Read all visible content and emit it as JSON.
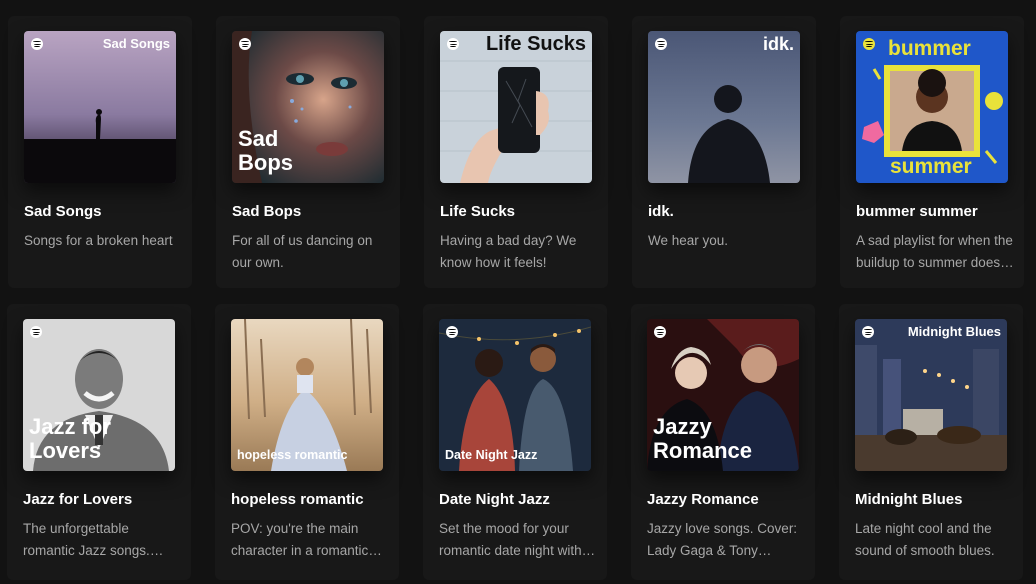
{
  "cards": [
    {
      "title": "Sad Songs",
      "desc": "Songs for a broken heart",
      "art_label": "Sad Songs"
    },
    {
      "title": "Sad Bops",
      "desc": "For all of us dancing on our own.",
      "art_label": "Sad Bops"
    },
    {
      "title": "Life Sucks",
      "desc": "Having a bad day? We know how it feels!",
      "art_label": "Life Sucks"
    },
    {
      "title": "idk.",
      "desc": "We hear you.",
      "art_label": "idk."
    },
    {
      "title": "bummer summer",
      "desc": "A sad playlist for when the buildup to summer doesn't quite pan out.",
      "art_label_top": "bummer",
      "art_label_bottom": "summer"
    },
    {
      "title": "Jazz for Lovers",
      "desc": "The unforgettable romantic Jazz songs. Cover: Nat King Cole",
      "art_label": "Jazz for Lovers"
    },
    {
      "title": "hopeless romantic",
      "desc": "POV: you're the main character in a romantic comedy",
      "art_label": "hopeless romantic"
    },
    {
      "title": "Date Night Jazz",
      "desc": "Set the mood for your romantic date night with these jazz tunes.",
      "art_label": "Date Night Jazz"
    },
    {
      "title": "Jazzy Romance",
      "desc": "Jazzy love songs. Cover: Lady Gaga & Tony Bennett",
      "art_label": "Jazzy Romance"
    },
    {
      "title": "Midnight Blues",
      "desc": "Late night cool and the sound of smooth blues.",
      "art_label": "Midnight Blues"
    }
  ],
  "colors": {
    "background": "#121212",
    "card": "#181818",
    "title": "#ffffff",
    "desc": "#a7a7a7",
    "bummer_yellow": "#e9e23a",
    "bummer_blue": "#1f57c9"
  }
}
